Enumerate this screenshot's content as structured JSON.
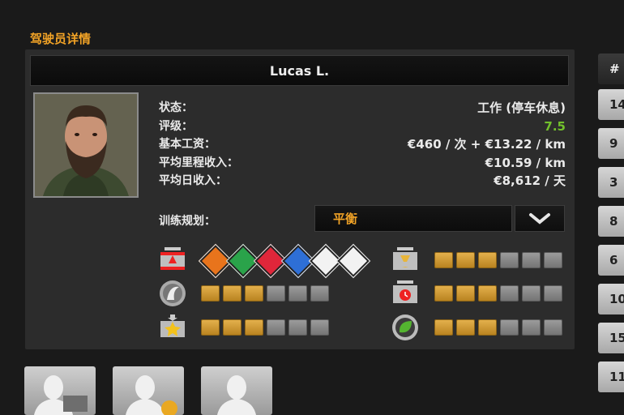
{
  "section_title": "驾驶员详情",
  "driver": {
    "name": "Lucas L.",
    "labels": {
      "status": "状态：",
      "rating": "评级：",
      "base_salary": "基本工资：",
      "avg_distance_income": "平均里程收入：",
      "avg_daily_income": "平均日收入："
    },
    "values": {
      "status": "工作 (停车休息)",
      "rating": "7.5",
      "base_salary": "€460 / 次 + €13.22 / km",
      "avg_distance_income": "€10.59 / km",
      "avg_daily_income": "€8,612 / 天"
    }
  },
  "training": {
    "label": "训练规划：",
    "selected": "平衡"
  },
  "skills": {
    "adr_colors": [
      "#e8741c",
      "#2aa34a",
      "#e0263a",
      "#2e6fd6",
      "#f2f2f2",
      "#f2f2f2"
    ],
    "levels": {
      "long_distance": 3,
      "high_value_cargo": 3,
      "fragile_cargo": 3,
      "just_in_time": 3,
      "ecodriving": 3
    },
    "icons": [
      "adr-skill-icon",
      "long-distance-icon",
      "high-value-cargo-icon",
      "fragile-cargo-icon",
      "just-in-time-icon",
      "ecodriving-icon"
    ]
  },
  "right_list": {
    "header": "#",
    "items": [
      "14",
      "9",
      "3",
      "8",
      "6",
      "10",
      "15",
      "11"
    ]
  },
  "colors": {
    "accent_orange": "#f2a326",
    "rating_green": "#72c02c"
  }
}
